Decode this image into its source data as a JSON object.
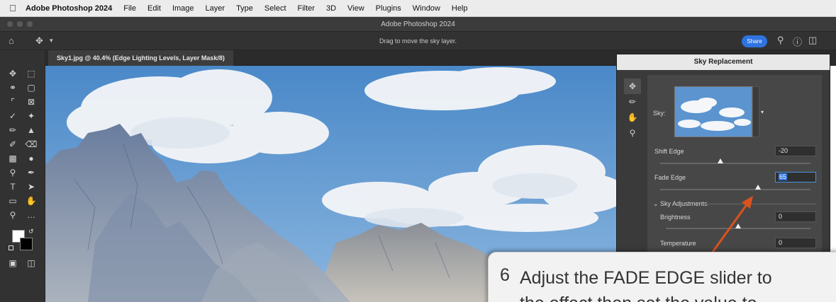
{
  "menubar": {
    "app_name": "Adobe Photoshop 2024",
    "items": [
      "File",
      "Edit",
      "Image",
      "Layer",
      "Type",
      "Select",
      "Filter",
      "3D",
      "View",
      "Plugins",
      "Window",
      "Help"
    ]
  },
  "window": {
    "title": "Adobe Photoshop 2024"
  },
  "options_bar": {
    "hint": "Drag to move the sky layer.",
    "share_label": "Share"
  },
  "document": {
    "tab_label": "Sky1.jpg @ 40.4% (Edge Lighting Levels, Layer Mask/8)"
  },
  "sky_panel": {
    "title": "Sky Replacement",
    "sky_label": "Sky:",
    "shift_edge": {
      "label": "Shift Edge",
      "value": "-20",
      "level_pct": 40
    },
    "fade_edge": {
      "label": "Fade Edge",
      "value": "65",
      "level_pct": 65
    },
    "sky_adjustments_label": "Sky Adjustments",
    "brightness": {
      "label": "Brightness",
      "value": "0",
      "level_pct": 50
    },
    "temperature": {
      "label": "Temperature",
      "value": "0"
    }
  },
  "callout": {
    "number": "6",
    "line1": "Adjust the FADE EDGE slider to",
    "line2": "the effect then set the value to"
  },
  "colors": {
    "accent": "#2f73e0",
    "arrow": "#d9531e",
    "ui_dark": "#323232"
  },
  "icons": [
    "apple-icon",
    "home-icon",
    "move-icon",
    "search-icon",
    "help-icon",
    "panel-icon",
    "hand-icon",
    "zoom-icon",
    "brush-icon"
  ]
}
